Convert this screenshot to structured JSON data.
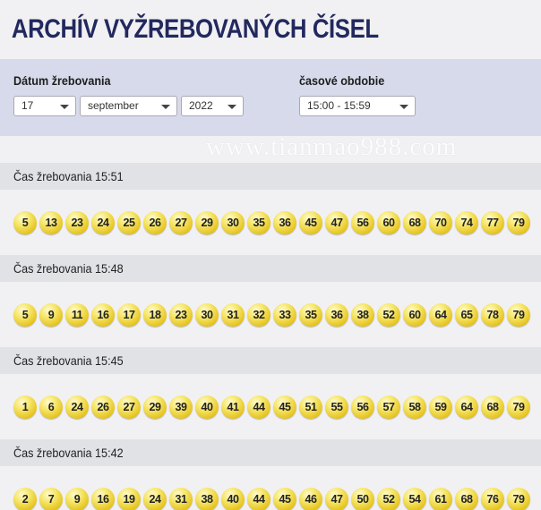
{
  "title": "ARCHÍV VYŽREBOVANÝCH ČÍSEL",
  "filters": {
    "date_label": "Dátum žrebovania",
    "day": "17",
    "month": "september",
    "year": "2022",
    "period_label": "časové obdobie",
    "period": "15:00 - 15:59"
  },
  "watermark": "www.tianmao988.com",
  "draws": [
    {
      "label": "Čas žrebovania 15:51",
      "numbers": [
        "5",
        "13",
        "23",
        "24",
        "25",
        "26",
        "27",
        "29",
        "30",
        "35",
        "36",
        "45",
        "47",
        "56",
        "60",
        "68",
        "70",
        "74",
        "77",
        "79"
      ]
    },
    {
      "label": "Čas žrebovania 15:48",
      "numbers": [
        "5",
        "9",
        "11",
        "16",
        "17",
        "18",
        "23",
        "30",
        "31",
        "32",
        "33",
        "35",
        "36",
        "38",
        "52",
        "60",
        "64",
        "65",
        "78",
        "79"
      ]
    },
    {
      "label": "Čas žrebovania 15:45",
      "numbers": [
        "1",
        "6",
        "24",
        "26",
        "27",
        "29",
        "39",
        "40",
        "41",
        "44",
        "45",
        "51",
        "55",
        "56",
        "57",
        "58",
        "59",
        "64",
        "68",
        "79"
      ]
    },
    {
      "label": "Čas žrebovania 15:42",
      "numbers": [
        "2",
        "7",
        "9",
        "16",
        "19",
        "24",
        "31",
        "38",
        "40",
        "44",
        "45",
        "46",
        "47",
        "50",
        "52",
        "54",
        "61",
        "68",
        "76",
        "79"
      ]
    }
  ]
}
